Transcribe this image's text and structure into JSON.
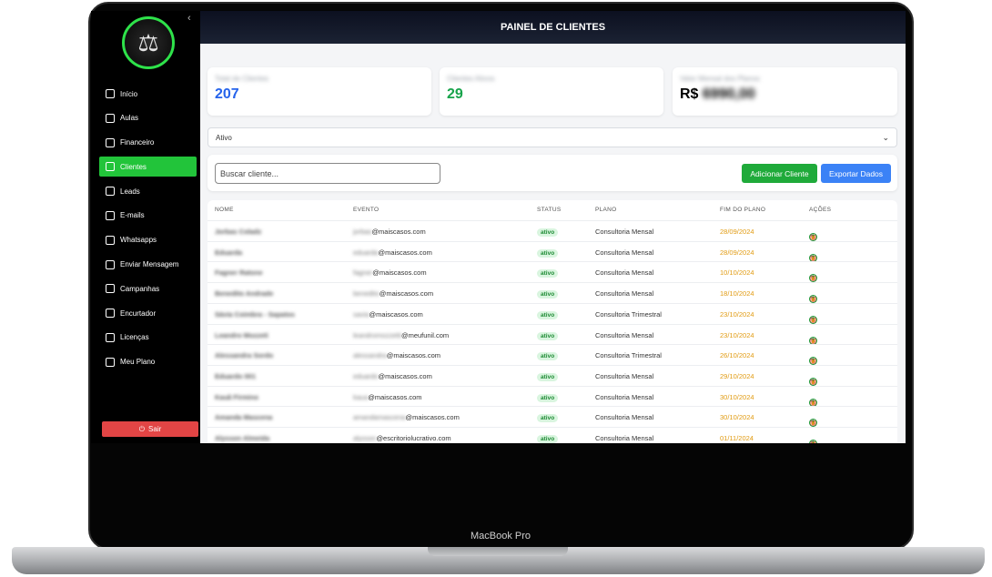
{
  "device": {
    "label": "MacBook Pro"
  },
  "header": {
    "title": "PAINEL DE CLIENTES"
  },
  "sidebar": {
    "collapse_icon": "chevron-left-icon",
    "items": [
      {
        "label": "Início",
        "icon": "home-icon",
        "active": false
      },
      {
        "label": "Aulas",
        "icon": "graduation-icon",
        "active": false
      },
      {
        "label": "Financeiro",
        "icon": "dollar-icon",
        "active": false
      },
      {
        "label": "Clientes",
        "icon": "users-icon",
        "active": true
      },
      {
        "label": "Leads",
        "icon": "briefcase-icon",
        "active": false
      },
      {
        "label": "E-mails",
        "icon": "mail-icon",
        "active": false
      },
      {
        "label": "Whatsapps",
        "icon": "qrcode-icon",
        "active": false
      },
      {
        "label": "Enviar Mensagem",
        "icon": "send-icon",
        "active": false
      },
      {
        "label": "Campanhas",
        "icon": "megaphone-icon",
        "active": false
      },
      {
        "label": "Encurtador",
        "icon": "link-icon",
        "active": false
      },
      {
        "label": "Licenças",
        "icon": "key-icon",
        "active": false
      },
      {
        "label": "Meu Plano",
        "icon": "clipboard-icon",
        "active": false
      }
    ],
    "logout_label": "Sair"
  },
  "stats": {
    "total": {
      "label": "Total de Clientes",
      "value": "207",
      "color": "#2563eb"
    },
    "active": {
      "label": "Clientes Ativos",
      "value": "29",
      "color": "#16a34a"
    },
    "revenue": {
      "label": "Valor Mensal dos Planos",
      "prefix": "R$",
      "value": "6990,00",
      "color": "#111111"
    }
  },
  "filter": {
    "selected": "Ativo"
  },
  "toolbar": {
    "search_placeholder": "Buscar cliente...",
    "add_label": "Adicionar Cliente",
    "export_label": "Exportar Dados"
  },
  "table": {
    "headers": {
      "name": "NOME",
      "event": "EVENTO",
      "status": "STATUS",
      "plan": "PLANO",
      "end": "FIM DO PLANO",
      "actions": "AÇÕES"
    },
    "rows": [
      {
        "name": "Jorbas Coladz",
        "email_user": "jorbas",
        "email_domain": "@maiscasos.com",
        "status": "ativo",
        "plan": "Consultoria Mensal",
        "end": "28/09/2024"
      },
      {
        "name": "Eduarda",
        "email_user": "eduarda",
        "email_domain": "@maiscasos.com",
        "status": "ativo",
        "plan": "Consultoria Mensal",
        "end": "28/09/2024"
      },
      {
        "name": "Fagner Ratone",
        "email_user": "fagner",
        "email_domain": "@maiscasos.com",
        "status": "ativo",
        "plan": "Consultoria Mensal",
        "end": "10/10/2024"
      },
      {
        "name": "Benedito Andrade",
        "email_user": "benedito",
        "email_domain": "@maiscasos.com",
        "status": "ativo",
        "plan": "Consultoria Mensal",
        "end": "18/10/2024"
      },
      {
        "name": "Sávia Coimbra - Sapatos",
        "email_user": "savia",
        "email_domain": "@maiscasos.com",
        "status": "ativo",
        "plan": "Consultoria Trimestral",
        "end": "23/10/2024"
      },
      {
        "name": "Leandro Mozzeti",
        "email_user": "leandromozzetti",
        "email_domain": "@meufunil.com",
        "status": "ativo",
        "plan": "Consultoria Mensal",
        "end": "23/10/2024"
      },
      {
        "name": "Alessandra Sordo",
        "email_user": "alessandra",
        "email_domain": "@maiscasos.com",
        "status": "ativo",
        "plan": "Consultoria Trimestral",
        "end": "26/10/2024"
      },
      {
        "name": "Eduardo 001",
        "email_user": "eduardo",
        "email_domain": "@maiscasos.com",
        "status": "ativo",
        "plan": "Consultoria Mensal",
        "end": "29/10/2024"
      },
      {
        "name": "Kauã Firmino",
        "email_user": "kaua",
        "email_domain": "@maiscasos.com",
        "status": "ativo",
        "plan": "Consultoria Mensal",
        "end": "30/10/2024"
      },
      {
        "name": "Amanda Mascena",
        "email_user": "amandamascena",
        "email_domain": "@maiscasos.com",
        "status": "ativo",
        "plan": "Consultoria Mensal",
        "end": "30/10/2024"
      },
      {
        "name": "Alysson Almeida",
        "email_user": "alysson",
        "email_domain": "@escritoriolucrativo.com",
        "status": "ativo",
        "plan": "Consultoria Mensal",
        "end": "01/11/2024"
      }
    ]
  },
  "colors": {
    "accent_green": "#22c43a",
    "danger": "#e24545",
    "primary_blue": "#3b82f6",
    "date_orange": "#e19b12"
  }
}
